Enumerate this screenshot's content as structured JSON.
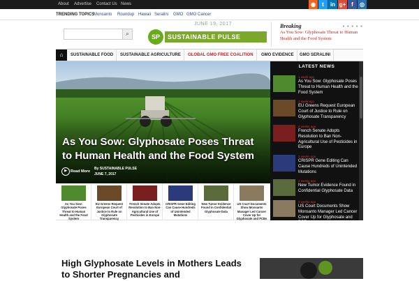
{
  "topbar": {
    "links": [
      "About",
      "Advertise",
      "Contact Us",
      "News"
    ],
    "social": [
      {
        "label": "rss",
        "char": "◉",
        "color": "#f26522"
      },
      {
        "label": "twitter",
        "char": "t",
        "color": "#1da1f2"
      },
      {
        "label": "linkedin",
        "char": "in",
        "color": "#0077b5"
      },
      {
        "label": "google-plus",
        "char": "g+",
        "color": "#dd4b39"
      },
      {
        "label": "facebook",
        "char": "f",
        "color": "#3b5998"
      },
      {
        "label": "other",
        "char": "◎",
        "color": "#2a6fb0"
      }
    ]
  },
  "trending": {
    "label": "TRENDING TOPICS",
    "topics": [
      "Monsanto",
      "Roundup",
      "Hawaii",
      "Seralini",
      "GMO",
      "GMO Cancer"
    ]
  },
  "header": {
    "date": "JUNE 19, 2017",
    "search_placeholder": "",
    "search_icon": "magnifier-icon",
    "logo_mark": "SP",
    "logo_text": "SUSTAINABLE PULSE",
    "brand_color": "#6aab1c"
  },
  "breaking": {
    "label": "Breaking",
    "dots": "● ● ● ● ●",
    "text": "As You Sow: Glyphosate Threat to Human Health and the Food System"
  },
  "nav": {
    "home_icon": "home-icon",
    "items": [
      "SUSTAINABLE FOOD",
      "SUSTAINABLE AGRICULTURE",
      "GLOBAL GMO FREE COALITION",
      "GMO EVIDENCE",
      "GMO SERALINI"
    ],
    "highlight_color": "#c0241f"
  },
  "hero": {
    "title": "As You Sow: Glyphosate Poses Threat to Human Health and the Food System",
    "read_more": "Read More",
    "by": "By SUSTAINABLE PULSE",
    "date": "JUNE 7, 2017"
  },
  "thumbs": [
    {
      "caption": "As You Sow: Glyphosate Poses Threat to Human Health and the Food System",
      "color": "#4f8a2e"
    },
    {
      "caption": "EU Greens Request European Court of Justice to Rule on Glyphosate Transparency",
      "color": "#6b4a2a"
    },
    {
      "caption": "French Senate Adopts Resolution to Ban Non-Agricultural Use of Pesticides in Europe",
      "color": "#7a1f1f"
    },
    {
      "caption": "CRISPR Gene Editing Can Cause Hundreds of Unintended Mutations",
      "color": "#2a3a7a"
    },
    {
      "caption": "New Tumor Evidence Found in Confidential Glyphosate Data",
      "color": "#5a6a3a"
    },
    {
      "caption": "US Court Documents Show Monsanto Manager Led Cancer Cover Up for Glyphosate and PCBs",
      "color": "#8a7a60"
    }
  ],
  "latest": {
    "heading": "LATEST NEWS",
    "items": [
      {
        "time": "1 week ago",
        "title": "As You Sow: Glyphosate Poses Threat to Human Health and the Food System",
        "color": "#4f8a2e"
      },
      {
        "time": "1 week ago",
        "title": "EU Greens Request European Court of Justice to Rule on Glyphosate Transparency",
        "color": "#6b4a2a"
      },
      {
        "time": "2 weeks ago",
        "title": "French Senate Adopts Resolution to Ban Non-Agricultural Use of Pesticides in Europe",
        "color": "#7a1f1f"
      },
      {
        "time": "2 weeks ago",
        "title": "CRISPR Gene Editing Can Cause Hundreds of Unintended Mutations",
        "color": "#2a3a7a"
      },
      {
        "time": "2 weeks ago",
        "title": "New Tumor Evidence Found in Confidential Glyphosate Data",
        "color": "#5a6a3a"
      },
      {
        "time": "3 weeks ago",
        "title": "US Court Documents Show Monsanto Manager Led Cancer Cover Up for Glyphosate and PCBs",
        "color": "#8a7a60"
      }
    ]
  },
  "article": {
    "headline": "High Glyphosate Levels in Mothers Leads to Shorter Pregnancies and"
  }
}
